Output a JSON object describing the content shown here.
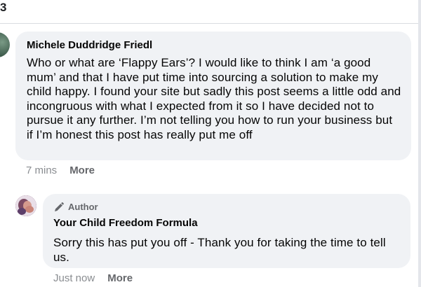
{
  "top": {
    "fragment": "3"
  },
  "comment": {
    "author": "Michele Duddridge Friedl",
    "text": "Who or what are ‘Flappy Ears’? I would like to think I am ‘a good mum’ and that I have put time into sourcing a solution to make my child happy. I found your site but sadly this post seems a little odd and incongruous with what I expected from it so I have decided not to pursue it any further. I’m not telling you how to run your business but if I’m honest this post has really put me off",
    "time": "7 mins",
    "more_label": "More"
  },
  "reply": {
    "badge": "Author",
    "author": "Your Child Freedom Formula",
    "text": "Sorry this has put you off - Thank you for taking the time to tell us.",
    "time": "Just now",
    "more_label": "More"
  }
}
